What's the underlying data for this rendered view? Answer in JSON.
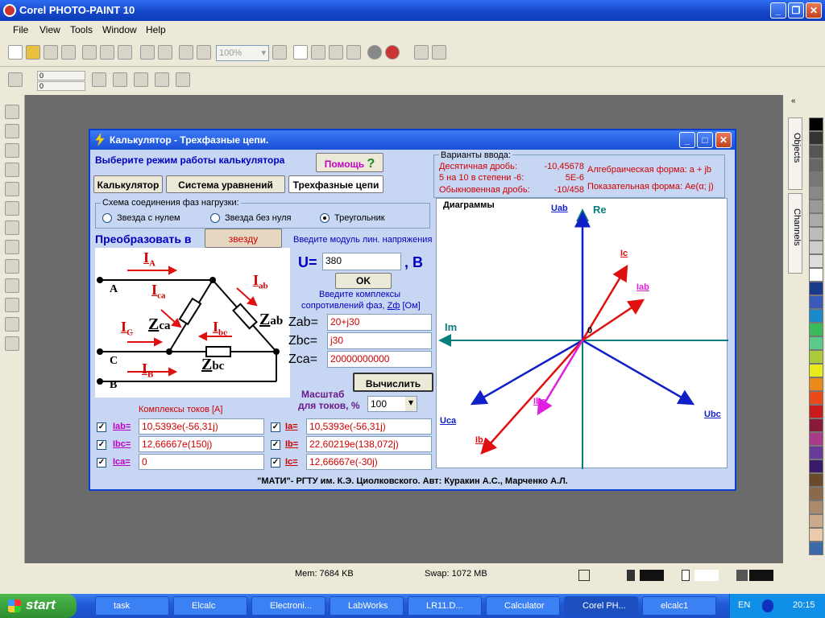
{
  "window": {
    "title": "Corel PHOTO-PAINT 10"
  },
  "menu": [
    "File",
    "View",
    "Tools",
    "Window",
    "Help"
  ],
  "toolbar": {
    "zoom": "100%",
    "pos_x": "0",
    "pos_y": "0"
  },
  "right_tabs": [
    "Objects",
    "Channels"
  ],
  "status": {
    "mem": "Mem: 7684 KB",
    "swap": "Swap: 1072 MB"
  },
  "taskbar": {
    "start": "start",
    "items": [
      "task",
      "Elcalc",
      "Electroni...",
      "LabWorks",
      "LR11.D...",
      "Calculator",
      "Corel PH...",
      "elcalc1"
    ],
    "lang": "EN",
    "clock": "20:15"
  },
  "dialog": {
    "title": "Калькулятор - Трехфазные цепи.",
    "mode_prompt": "Выберите режим работы калькулятора",
    "help": "Помощь",
    "tabs": [
      "Калькулятор",
      "Система уравнений",
      "Трехфазные цепи"
    ],
    "input_variants": {
      "heading": "Варианты ввода:",
      "rows": [
        {
          "label": "Десятичная дробь:",
          "value": "-10,45678"
        },
        {
          "label": "5 на 10 в степени -6:",
          "value": "5E-6"
        },
        {
          "label": "Обыкновенная дробь:",
          "value": "-10/458"
        }
      ],
      "alg": "Алгебраическая форма: a + jb",
      "exp": "Показательная форма: Ae(α; j)"
    },
    "scheme": {
      "heading": "Схема соединения фаз нагрузки:",
      "options": [
        "Звезда с нулем",
        "Звезда без нуля",
        "Треугольник"
      ],
      "selected": 2
    },
    "convert": {
      "label": "Преобразовать в",
      "button": "звезду"
    },
    "circuit": {
      "Ia": "I",
      "Ia_sub": "A",
      "Ica": "I",
      "Ica_sub": "ca",
      "Iab": "I",
      "Iab_sub": "ab",
      "Ic": "I",
      "Ic_sub": "C",
      "Ibc": "I",
      "Ibc_sub": "bc",
      "Ib": "I",
      "Ib_sub": "B",
      "Zca": "Z",
      "Zca_sub": "ca",
      "Zab": "Z",
      "Zab_sub": "ab",
      "Zbc": "Z",
      "Zbc_sub": "bc",
      "A": "A",
      "B": "B",
      "C": "C"
    },
    "voltage": {
      "prompt": "Введите модуль лин. напряжения",
      "label": "U=",
      "value": "380",
      "unit": ", B",
      "ok": "OK"
    },
    "impedance": {
      "prompt1": "Введите комплексы",
      "prompt2": "сопротивлений фаз,",
      "zf": "Zф",
      "ohm": "[Ом]",
      "rows": [
        {
          "label": "Zab=",
          "value": "20+j30"
        },
        {
          "label": "Zbc=",
          "value": "j30"
        },
        {
          "label": "Zca=",
          "value": "20000000000"
        }
      ]
    },
    "calc_button": "Вычислить",
    "scale": {
      "label1": "Масштаб",
      "label2": "для токов, %",
      "value": "100"
    },
    "currents_heading": "Комплексы токов [A]",
    "currents_left": [
      {
        "label": "Iab=",
        "value": "10,5393e(-56,31j)"
      },
      {
        "label": "Ibc=",
        "value": "12,66667e(150j)"
      },
      {
        "label": "Ica=",
        "value": "0"
      }
    ],
    "currents_right": [
      {
        "label": "Ia=",
        "value": "10,5393e(-56,31j)"
      },
      {
        "label": "Ib=",
        "value": "22,60219e(138,072j)"
      },
      {
        "label": "Ic=",
        "value": "12,66667e(-30j)"
      }
    ],
    "diagram": {
      "title": "Диаграммы",
      "Re": "Re",
      "Im": "Im",
      "zero": "0",
      "Uab": "Uab",
      "Ubc": "Ubc",
      "Uca": "Uca",
      "Ic": "Ic",
      "Iab": "Iab",
      "Ibc": "Ibc",
      "Ib": "Ib"
    },
    "footer": "\"МАТИ\"- РГТУ им. К.Э. Циолковского. Авт: Куракин А.С., Марченко А.Л."
  },
  "colors": {
    "title": "#2358d8",
    "dialog_bg": "#c6d6f3",
    "red": "#e01010",
    "blue": "#1020c8",
    "teal": "#0a7e7e",
    "magenta": "#e020e0"
  }
}
